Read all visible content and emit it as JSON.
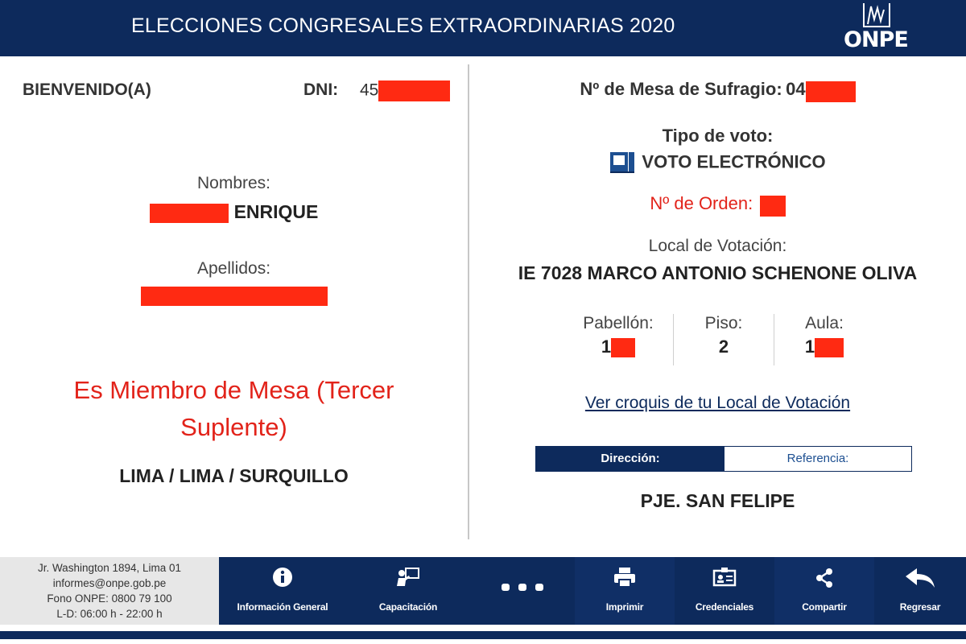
{
  "header": {
    "title": "ELECCIONES CONGRESALES EXTRAORDINARIAS 2020",
    "logo_text": "ONPE"
  },
  "left": {
    "welcome": "BIENVENIDO(A)",
    "dni_label": "DNI:",
    "dni_value_visible": "45",
    "nombres_label": "Nombres:",
    "nombres_value_visible": "ENRIQUE",
    "apellidos_label": "Apellidos:",
    "miembro_line1": "Es Miembro de Mesa (Tercer",
    "miembro_line2": "Suplente)",
    "ubigeo": "LIMA / LIMA / SURQUILLO"
  },
  "right": {
    "mesa_label": "Nº de Mesa de Sufragio:",
    "mesa_value_visible": "04",
    "tipo_label": "Tipo de voto:",
    "tipo_value": "VOTO ELECTRÓNICO",
    "orden_label": "Nº de Orden:",
    "local_label": "Local de Votación:",
    "local_value": "IE 7028 MARCO ANTONIO SCHENONE OLIVA",
    "pabellon_label": "Pabellón:",
    "pabellon_value_visible": "1",
    "piso_label": "Piso:",
    "piso_value": "2",
    "aula_label": "Aula:",
    "aula_value_visible": "1",
    "croquis_link": "Ver croquis de tu Local de Votación",
    "tab_direccion": "Dirección:",
    "tab_referencia": "Referencia:",
    "direccion_value": "PJE. SAN FELIPE"
  },
  "footer": {
    "address": "Jr. Washington 1894, Lima 01",
    "email": "informes@onpe.gob.pe",
    "phone": "Fono ONPE: 0800 79 100",
    "hours": "L-D: 06:00 h - 22:00 h",
    "nav": [
      {
        "label": "Información General",
        "icon": "info-icon"
      },
      {
        "label": "Capacitación",
        "icon": "training-icon"
      },
      {
        "label": "",
        "icon": "more-icon"
      },
      {
        "label": "Imprimir",
        "icon": "printer-icon"
      },
      {
        "label": "Credenciales",
        "icon": "credential-icon"
      },
      {
        "label": "Compartir",
        "icon": "share-icon"
      },
      {
        "label": "Regresar",
        "icon": "back-icon"
      }
    ]
  },
  "colors": {
    "brand_navy": "#0d2a5c",
    "alert_red": "#e2231a",
    "redaction": "#ff2a12"
  }
}
